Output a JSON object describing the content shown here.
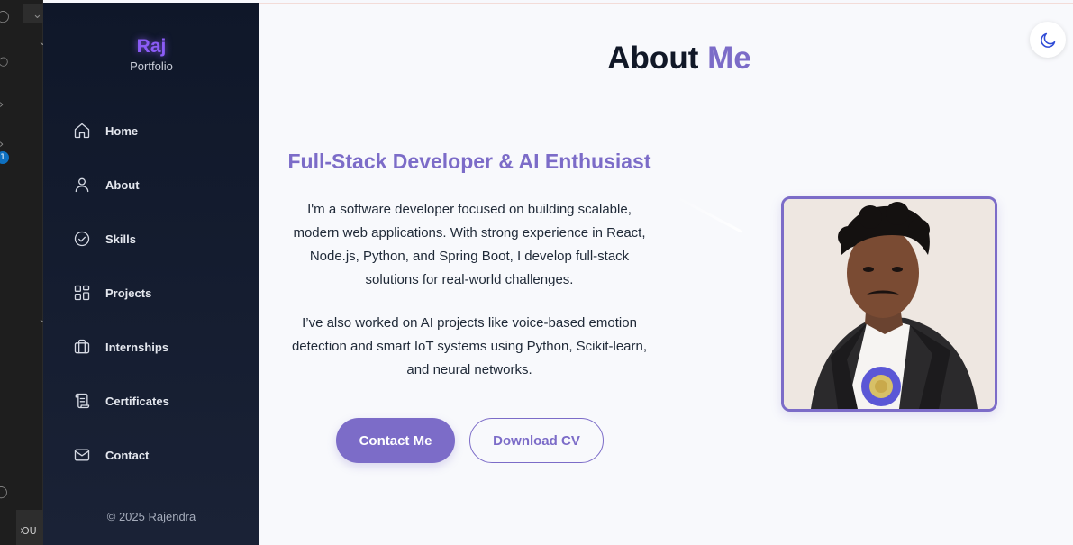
{
  "editor": {
    "badge": "1",
    "panel_label": "OU"
  },
  "sidebar": {
    "brand": "Raj",
    "brand_sub": "Portfolio",
    "items": [
      {
        "label": "Home",
        "icon": "home-icon"
      },
      {
        "label": "About",
        "icon": "user-icon"
      },
      {
        "label": "Skills",
        "icon": "check-circle-icon"
      },
      {
        "label": "Projects",
        "icon": "layout-grid-icon"
      },
      {
        "label": "Internships",
        "icon": "briefcase-icon"
      },
      {
        "label": "Certificates",
        "icon": "scroll-icon"
      },
      {
        "label": "Contact",
        "icon": "mail-icon"
      }
    ],
    "copyright": "© 2025 Rajendra"
  },
  "main": {
    "title_prefix": "About",
    "title_accent": "Me",
    "subtitle": "Full-Stack Developer & AI Enthusiast",
    "paragraph_1": "I'm a software developer focused on building scalable, modern web applications. With strong experience in React, Node.js, Python, and Spring Boot, I develop full-stack solutions for real-world challenges.",
    "paragraph_2": "I’ve also worked on AI projects like voice-based emotion detection and smart IoT systems using Python, Scikit-learn, and neural networks.",
    "contact_button": "Contact Me",
    "cv_button": "Download CV",
    "theme_icon": "moon-icon"
  },
  "colors": {
    "accent": "#7c6cc8",
    "brand_glow": "#8b5cf6",
    "sidebar_bg": "#0f1729",
    "toggle_icon": "#2f4bd6"
  }
}
